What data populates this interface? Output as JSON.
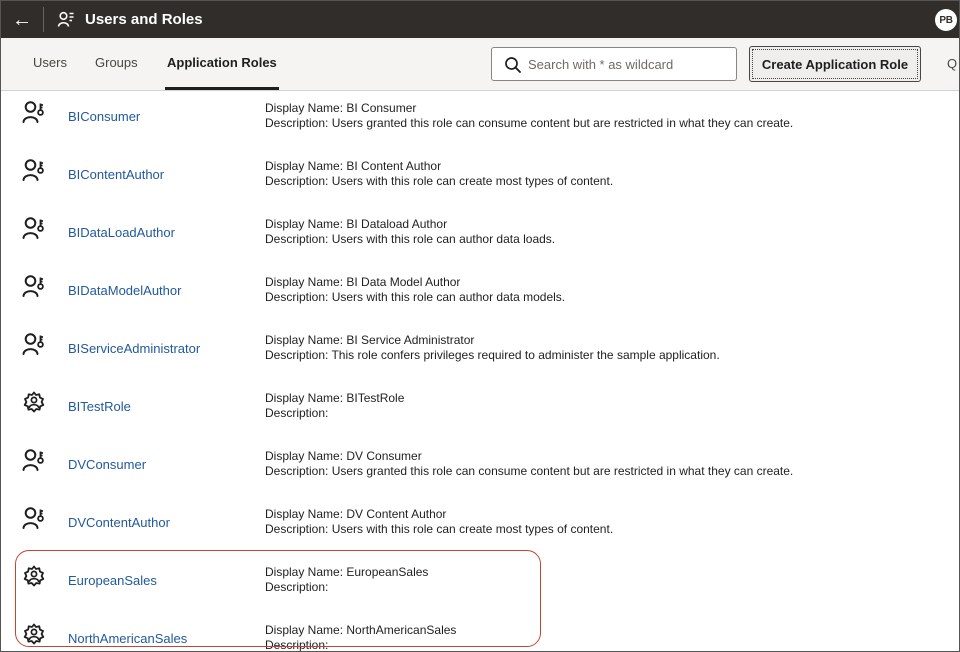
{
  "header": {
    "title": "Users and Roles",
    "avatar_initials": "PB"
  },
  "tabs": [
    {
      "label": "Users",
      "active": false
    },
    {
      "label": "Groups",
      "active": false
    },
    {
      "label": "Application Roles",
      "active": true
    }
  ],
  "search": {
    "placeholder": "Search with * as wildcard",
    "value": ""
  },
  "toolbar": {
    "create_label": "Create Application Role",
    "overflow_label": "Q"
  },
  "roles": [
    {
      "name": "BIConsumer",
      "icon": "user-role-icon",
      "display_name": "Display Name: BI Consumer",
      "description": "Description: Users granted this role can consume content but are restricted in what they can create."
    },
    {
      "name": "BIContentAuthor",
      "icon": "user-role-icon",
      "display_name": "Display Name: BI Content Author",
      "description": "Description: Users with this role can create most types of content."
    },
    {
      "name": "BIDataLoadAuthor",
      "icon": "user-role-icon",
      "display_name": "Display Name: BI Dataload Author",
      "description": "Description: Users with this role can author data loads."
    },
    {
      "name": "BIDataModelAuthor",
      "icon": "user-role-icon",
      "display_name": "Display Name: BI Data Model Author",
      "description": "Description: Users with this role can author data models."
    },
    {
      "name": "BIServiceAdministrator",
      "icon": "user-role-icon",
      "display_name": "Display Name: BI Service Administrator",
      "description": "Description: This role confers privileges required to administer the sample application."
    },
    {
      "name": "BITestRole",
      "icon": "gear-role-icon",
      "display_name": "Display Name: BITestRole",
      "description": "Description:"
    },
    {
      "name": "DVConsumer",
      "icon": "user-role-icon",
      "display_name": "Display Name: DV Consumer",
      "description": "Description: Users granted this role can consume content but are restricted in what they can create."
    },
    {
      "name": "DVContentAuthor",
      "icon": "user-role-icon",
      "display_name": "Display Name: DV Content Author",
      "description": "Description: Users with this role can create most types of content."
    },
    {
      "name": "EuropeanSales",
      "icon": "gear-role-icon",
      "display_name": "Display Name: EuropeanSales",
      "description": "Description:"
    },
    {
      "name": "NorthAmericanSales",
      "icon": "gear-role-icon",
      "display_name": "Display Name: NorthAmericanSales",
      "description": "Description:"
    }
  ],
  "colors": {
    "titlebar_bg": "#312d2a",
    "link": "#22599c",
    "highlight_outline": "#c0462f"
  }
}
